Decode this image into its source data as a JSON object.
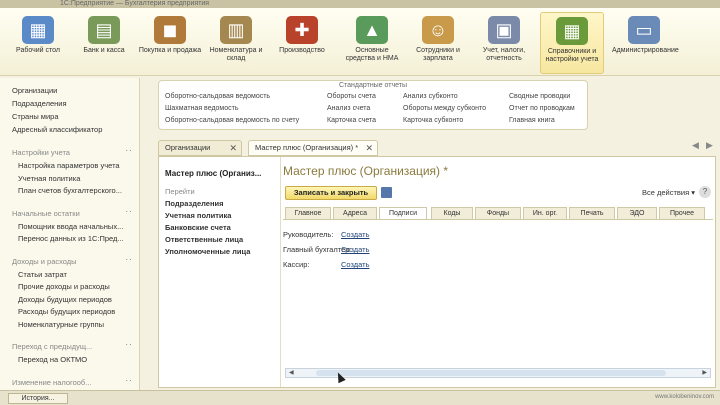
{
  "titlebar": {
    "text": "1С:Предприятие — Бухгалтерия предприятия"
  },
  "sections": [
    {
      "label": "Рабочий стол",
      "icon": "desktop-icon",
      "color": "#5a8ac8",
      "glyph": "▦"
    },
    {
      "label": "Банк и касса",
      "icon": "bank-icon",
      "color": "#7a9a5a",
      "glyph": "▤"
    },
    {
      "label": "Покупка и продажа",
      "icon": "cart-icon",
      "color": "#b07a3a",
      "glyph": "◼"
    },
    {
      "label": "Номенклатура и склад",
      "icon": "warehouse-icon",
      "color": "#a58850",
      "glyph": "▥"
    },
    {
      "label": "Производство",
      "icon": "toolbox-icon",
      "color": "#b8422a",
      "glyph": "✚"
    },
    {
      "label": "Основные средства и НМА",
      "icon": "assets-icon",
      "color": "#5a9a5a",
      "glyph": "▲"
    },
    {
      "label": "Сотрудники и зарплата",
      "icon": "employee-icon",
      "color": "#c89a4a",
      "glyph": "☺"
    },
    {
      "label": "Учет, налоги, отчетность",
      "icon": "report-icon",
      "color": "#7a8aa8",
      "glyph": "▣"
    },
    {
      "label": "Справочники и настройки учета",
      "icon": "binder-icon",
      "color": "#6a9a3a",
      "glyph": "▦"
    },
    {
      "label": "Администрирование",
      "icon": "computer-icon",
      "color": "#6a8ab8",
      "glyph": "▭"
    }
  ],
  "left_panel": {
    "top_items": [
      "Организации",
      "Подразделения",
      "Страны мира",
      "Адресный классификатор"
    ],
    "groups": [
      {
        "title": "Настройки учета",
        "items": [
          "Настройка параметров учета",
          "Учетная политика",
          "План счетов бухгалтерского..."
        ]
      },
      {
        "title": "Начальные остатки",
        "items": [
          "Помощник ввода начальных...",
          "Перенос данных из 1С:Пред..."
        ]
      },
      {
        "title": "Доходы и расходы",
        "items": [
          "Статьи затрат",
          "Прочие доходы и расходы",
          "Доходы будущих периодов",
          "Расходы будущих периодов",
          "Номенклатурные группы"
        ]
      },
      {
        "title": "Переход с предыдущ...",
        "items": [
          "Переход на ОКТМО"
        ]
      },
      {
        "title": "Изменение налогооб...",
        "items": []
      }
    ]
  },
  "reports": {
    "header": "Стандартные отчеты",
    "col1": [
      "Оборотно-сальдовая ведомость",
      "Шахматная ведомость",
      "Оборотно-сальдовая ведомость по счету"
    ],
    "col2": [
      "Обороты счета",
      "Анализ счета",
      "Карточка счета"
    ],
    "col3": [
      "Анализ субконто",
      "Обороты между субконто",
      "Карточка субконто"
    ],
    "col4": [
      "Сводные проводки",
      "Отчет по проводкам",
      "Главная книга"
    ]
  },
  "window_tabs": [
    {
      "label": "Организации"
    },
    {
      "label": "Мастер плюс (Организация) *"
    }
  ],
  "form": {
    "nav_title": "Мастер плюс (Организ...",
    "nav_go": "Перейти",
    "nav_links": [
      "Подразделения",
      "Учетная политика",
      "Банковские счета",
      "Ответственные лица",
      "Уполномоченные лица"
    ],
    "title": "Мастер плюс (Организация) *",
    "save_button": "Записать и закрыть",
    "all_actions": "Все действия ▾",
    "help": "?",
    "tabs": [
      "Главное",
      "Адреса",
      "Подписи",
      "Коды",
      "Фонды",
      "Ин. орг.",
      "Печать",
      "ЭДО",
      "Прочее"
    ],
    "active_tab": 2,
    "signatures": [
      {
        "label": "Руководитель:",
        "link": "Создать"
      },
      {
        "label": "Главный бухгалтер:",
        "link": "Создать"
      },
      {
        "label": "Кассир:",
        "link": "Создать"
      }
    ]
  },
  "taskbar": {
    "history": "История...",
    "watermark": "www.kolobeninov.com"
  }
}
